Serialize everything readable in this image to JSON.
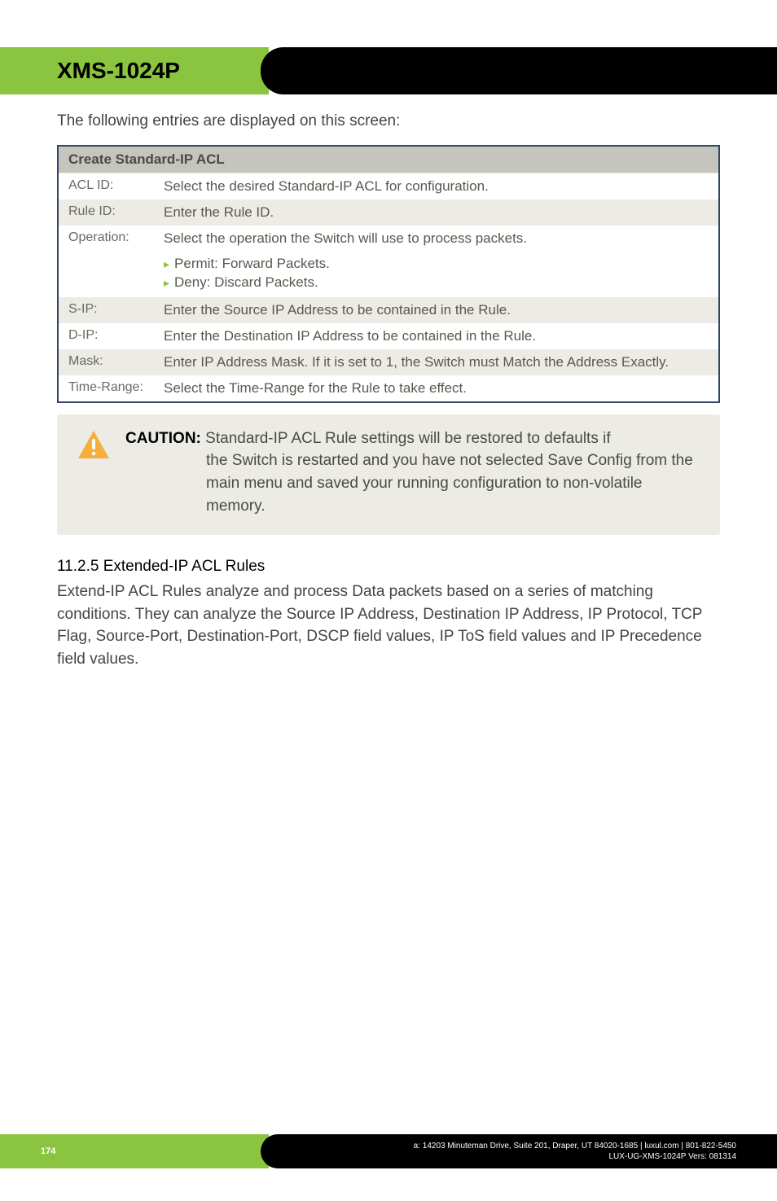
{
  "header": {
    "product": "XMS-1024P"
  },
  "intro_text": "The following entries are displayed on this screen:",
  "table": {
    "title": "Create Standard-IP ACL",
    "rows": [
      {
        "label": "ACL ID:",
        "text": "Select the desired Standard-IP ACL for configuration."
      },
      {
        "label": "Rule ID:",
        "text": "Enter the Rule ID."
      },
      {
        "label": "Operation:",
        "text": "Select the operation the Switch will use to process packets.",
        "bullets": [
          "Permit: Forward Packets.",
          "Deny: Discard Packets."
        ]
      },
      {
        "label": "S-IP:",
        "text": "Enter the Source IP Address to be contained in the Rule."
      },
      {
        "label": "D-IP:",
        "text": "Enter the Destination IP Address to be contained in the Rule."
      },
      {
        "label": "Mask:",
        "text": "Enter IP Address Mask. If it is set to 1, the Switch must Match the Address Exactly."
      },
      {
        "label": "Time-Range:",
        "text": "Select the Time-Range for the Rule to take effect."
      }
    ]
  },
  "caution": {
    "label": "CAUTION:",
    "first_line": " Standard-IP ACL Rule settings will be restored to defaults if",
    "rest": "the Switch is restarted and you have not selected Save Config from the main menu and saved your running configuration to non-volatile memory."
  },
  "section": {
    "heading": "11.2.5 Extended-IP ACL Rules",
    "body": "Extend-IP ACL Rules analyze and process Data packets based on a series of matching conditions. They can analyze the Source IP Address, Destination IP Address, IP Protocol, TCP Flag, Source-Port, Destination-Port, DSCP field values, IP ToS field values and IP Precedence field values."
  },
  "footer": {
    "page": "174",
    "address": "a: 14203 Minuteman Drive, Suite 201, Draper, UT 84020-1685 | luxul.com | 801-822-5450",
    "doc": "LUX-UG-XMS-1024P  Vers: 081314"
  }
}
